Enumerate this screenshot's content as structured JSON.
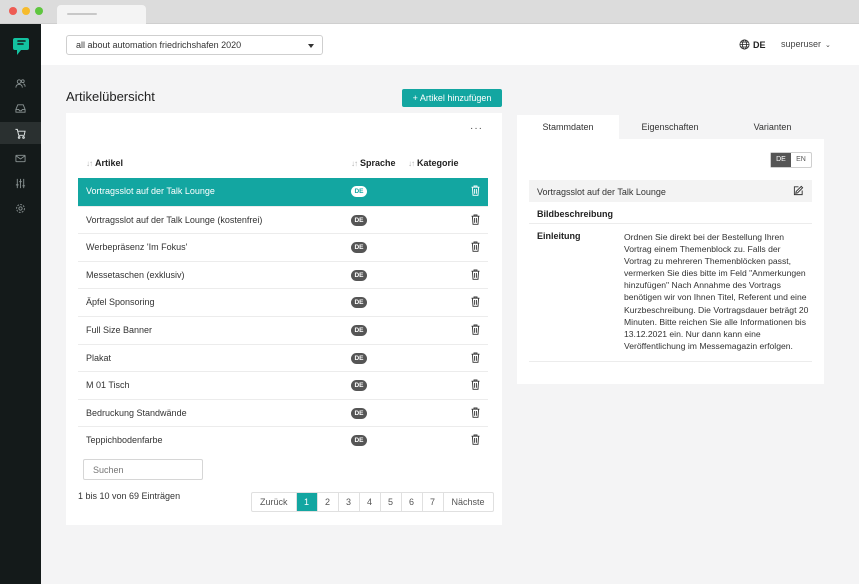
{
  "browser": {
    "tab_label": ""
  },
  "sidebar": {
    "items": [
      {
        "icon": "users-icon"
      },
      {
        "icon": "inbox-icon"
      },
      {
        "icon": "cart-icon",
        "active": true
      },
      {
        "icon": "mail-icon"
      },
      {
        "icon": "sliders-icon"
      },
      {
        "icon": "settings-icon"
      }
    ]
  },
  "topbar": {
    "event_select": "all about automation friedrichshafen 2020",
    "language": "DE",
    "user": "superuser"
  },
  "page": {
    "title": "Artikelübersicht",
    "add_button": "+ Artikel hinzufügen"
  },
  "table": {
    "more_label": "···",
    "headers": {
      "article": "Artikel",
      "language": "Sprache",
      "category": "Kategorie"
    },
    "rows": [
      {
        "name": "Vortragsslot auf der Talk Lounge",
        "lang": "DE",
        "active": true
      },
      {
        "name": "Vortragsslot auf der Talk Lounge (kostenfrei)",
        "lang": "DE"
      },
      {
        "name": "Werbepräsenz 'Im Fokus'",
        "lang": "DE"
      },
      {
        "name": "Messetaschen (exklusiv)",
        "lang": "DE"
      },
      {
        "name": "Äpfel Sponsoring",
        "lang": "DE"
      },
      {
        "name": "Full Size Banner",
        "lang": "DE"
      },
      {
        "name": "Plakat",
        "lang": "DE"
      },
      {
        "name": "M 01 Tisch",
        "lang": "DE"
      },
      {
        "name": "Bedruckung Standwände",
        "lang": "DE"
      },
      {
        "name": "Teppichbodenfarbe",
        "lang": "DE"
      }
    ],
    "search_placeholder": "Suchen",
    "info": "1 bis 10 von 69 Einträgen",
    "pagination": {
      "prev": "Zurück",
      "pages": [
        "1",
        "2",
        "3",
        "4",
        "5",
        "6",
        "7"
      ],
      "current": "1",
      "next": "Nächste"
    }
  },
  "detail": {
    "tabs": [
      "Stammdaten",
      "Eigenschaften",
      "Varianten"
    ],
    "active_tab": "Stammdaten",
    "lang_toggle": [
      "DE",
      "EN"
    ],
    "lang_active": "DE",
    "title": "Vortragsslot auf der Talk Lounge",
    "image_label": "Bildbeschreibung",
    "intro_label": "Einleitung",
    "intro_text": "Ordnen Sie direkt bei der Bestellung Ihren Vortrag einem Themenblock zu. Falls der Vortrag zu mehreren Themenblöcken passt, vermerken Sie dies bitte im Feld \"Anmerkungen hinzufügen\" Nach Annahme des Vortrags benötigen wir von Ihnen Titel, Referent und eine Kurzbeschreibung. Die Vortragsdauer beträgt 20 Minuten. Bitte reichen Sie alle Informationen bis 13.12.2021 ein. Nur dann kann eine Veröffentlichung im Messemagazin erfolgen."
  },
  "colors": {
    "accent": "#13a6a1",
    "sidebar": "#141a1a",
    "badge": "#555555"
  }
}
